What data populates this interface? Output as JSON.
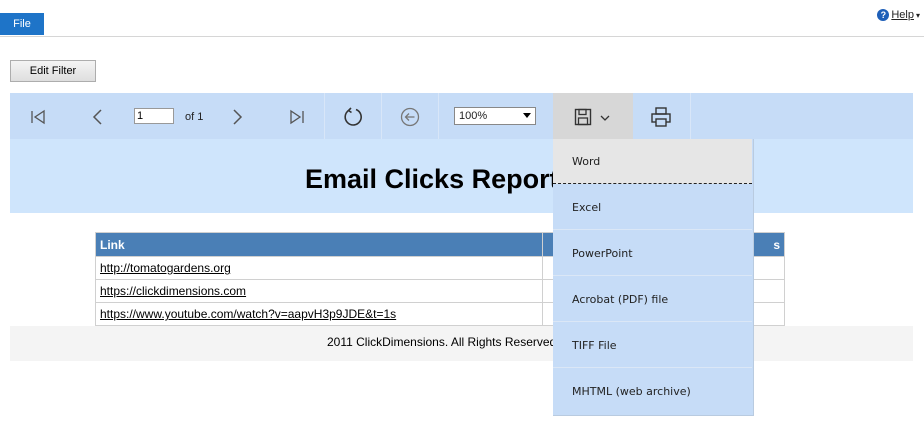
{
  "topbar": {
    "file_label": "File",
    "help_label": "Help",
    "help_caret": "▾"
  },
  "edit_filter_label": "Edit Filter",
  "toolbar": {
    "page_value": "1",
    "page_of": "of 1",
    "zoom_value": "100%"
  },
  "report": {
    "title": "Email Clicks Report",
    "columns": [
      "Link",
      "s"
    ],
    "rows": [
      {
        "link": "http://tomatogardens.org"
      },
      {
        "link": "https://clickdimensions.com"
      },
      {
        "link": "https://www.youtube.com/watch?v=aapvH3p9JDE&t=1s"
      }
    ],
    "footer": "2011 ClickDimensions. All Rights Reserved"
  },
  "export_menu": {
    "items": [
      "Word",
      "Excel",
      "PowerPoint",
      "Acrobat (PDF) file",
      "TIFF File",
      "MHTML (web archive)"
    ],
    "highlighted": "Word"
  },
  "colors": {
    "accent": "#1e74c8",
    "toolbar": "#c6dcf7",
    "table_header": "#4a7fb6"
  }
}
